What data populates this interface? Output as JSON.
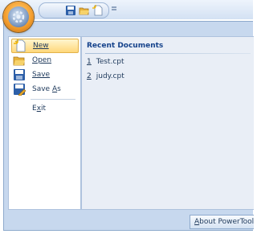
{
  "quick_access": {
    "icons": [
      "save-icon",
      "open-folder-icon",
      "new-document-icon"
    ],
    "customize_glyph": "="
  },
  "menu": {
    "items": [
      {
        "label": "New",
        "mnemonic_index": 0,
        "icon": "new-document-icon",
        "highlighted": true
      },
      {
        "label": "Open",
        "mnemonic_index": 0,
        "icon": "open-folder-icon",
        "highlighted": false
      },
      {
        "label": "Save",
        "mnemonic_index": 0,
        "icon": "save-icon",
        "highlighted": false
      },
      {
        "label": "Save As",
        "mnemonic_index": 5,
        "icon": "save-as-icon",
        "highlighted": false
      },
      {
        "label": "Exit",
        "mnemonic_index": 1,
        "icon": "",
        "highlighted": false
      }
    ]
  },
  "recent": {
    "header": "Recent Documents",
    "items": [
      {
        "num": "1",
        "name": "Test.cpt"
      },
      {
        "num": "2",
        "name": "judy.cpt"
      }
    ]
  },
  "about_button": {
    "label": "About PowerTool"
  },
  "colors": {
    "accent_orange": "#f5a030",
    "menu_frame": "#c7d8ee",
    "highlight": "#ffd77a",
    "text": "#1e395b"
  }
}
